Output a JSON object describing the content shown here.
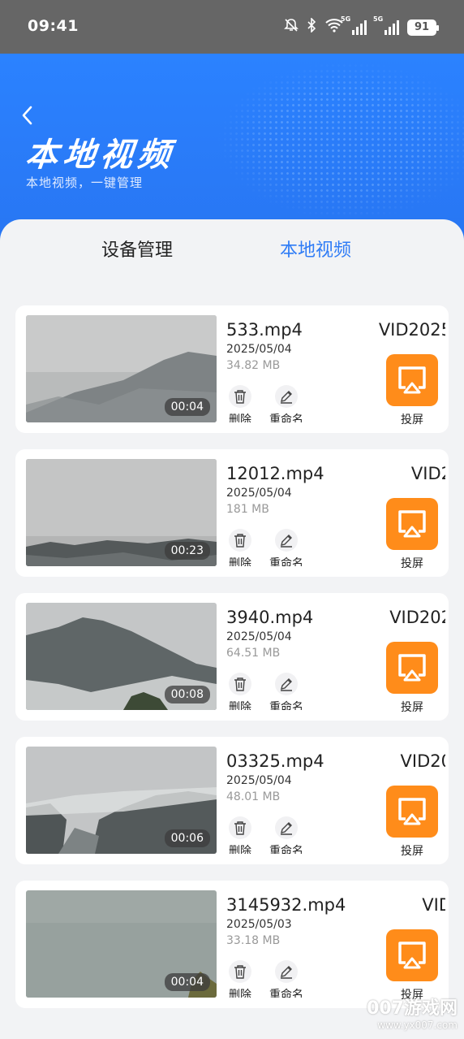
{
  "status_bar": {
    "time": "09:41",
    "network_tag": "5G",
    "battery": "91"
  },
  "header": {
    "title": "本地视频",
    "subtitle": "本地视频，一键管理"
  },
  "tabs": [
    {
      "label": "设备管理",
      "active": false
    },
    {
      "label": "本地视频",
      "active": true
    }
  ],
  "videos": [
    {
      "name": "533.mp4",
      "name_right": "VID2025",
      "date": "2025/05/04",
      "size": "34.82 MB",
      "duration": "00:04"
    },
    {
      "name": "12012.mp4",
      "name_right": "VID2",
      "date": "2025/05/04",
      "size": "181 MB",
      "duration": "00:23"
    },
    {
      "name": "3940.mp4",
      "name_right": "VID202",
      "date": "2025/05/04",
      "size": "64.51 MB",
      "duration": "00:08"
    },
    {
      "name": "03325.mp4",
      "name_right": "VID20",
      "date": "2025/05/04",
      "size": "48.01 MB",
      "duration": "00:06"
    },
    {
      "name": "3145932.mp4",
      "name_right": "VID",
      "date": "2025/05/03",
      "size": "33.18 MB",
      "duration": "00:04"
    }
  ],
  "actions": {
    "delete": "删除",
    "rename": "重命名",
    "cast": "投屏"
  },
  "watermark": {
    "line1": "007游戏网",
    "line2": "www.yx007.com"
  },
  "colors": {
    "header_blue": "#2b82ff",
    "tab_active": "#2f7cf6",
    "cast_orange": "#ff8c1a"
  }
}
